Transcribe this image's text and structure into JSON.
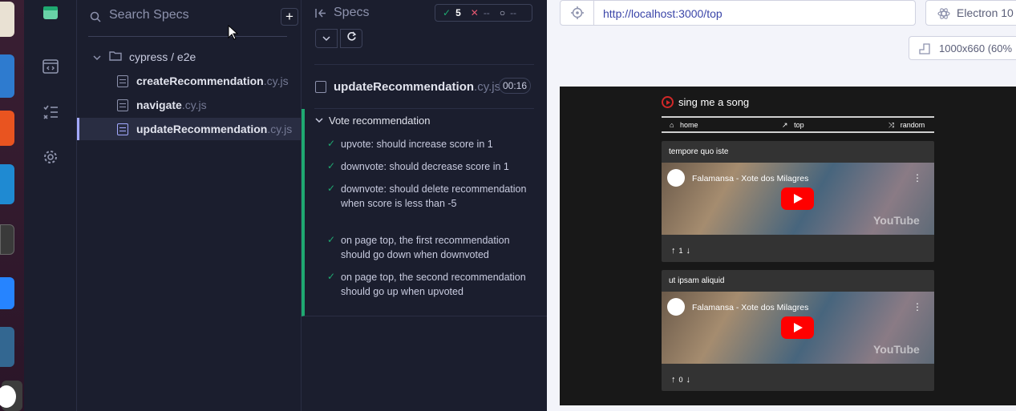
{
  "dock": {
    "apps": [
      {
        "name": "files",
        "color": "#e9e1d3"
      },
      {
        "name": "libreoffice-writer",
        "color": "#2e7bcf"
      },
      {
        "name": "software-center",
        "color": "#e95420"
      },
      {
        "name": "vscode",
        "color": "#1f8ad2"
      },
      {
        "name": "terminal",
        "color": "#3a3a3a"
      },
      {
        "name": "sourcetree",
        "color": "#2684ff"
      },
      {
        "name": "postgres",
        "color": "#336791"
      },
      {
        "name": "cypress",
        "color": "#ffffff"
      }
    ]
  },
  "rail": {
    "icons": [
      "cypress-logo-icon",
      "specs-browser-icon",
      "runs-list-icon",
      "settings-gear-icon"
    ]
  },
  "specs": {
    "search_placeholder": "Search Specs",
    "add_label": "+",
    "folder": "cypress / e2e",
    "files": [
      {
        "name": "createRecommendation",
        "ext": ".cy.js",
        "active": false
      },
      {
        "name": "navigate",
        "ext": ".cy.js",
        "active": false
      },
      {
        "name": "updateRecommendation",
        "ext": ".cy.js",
        "active": true
      }
    ]
  },
  "reporter": {
    "title": "Specs",
    "stats": {
      "passed": "5",
      "failed": "--",
      "pending": "--"
    },
    "run_file": {
      "name": "updateRecommendation",
      "ext": ".cy.js",
      "duration": "00:16"
    },
    "suite_title": "Vote recommendation",
    "tests": [
      "upvote: should increase score in 1",
      "downvote: should decrease score in 1",
      "downvote: should delete recommendation when score is less than -5",
      "on page top, the first recommendation should go down when downvoted",
      "on page top, the second recommendation should go up when upvoted"
    ]
  },
  "browser": {
    "url": "http://localhost:3000/top",
    "browser_name": "Electron 10",
    "viewport": "1000x660 (60%"
  },
  "app": {
    "logo_text": "sing me a song",
    "nav": [
      "home",
      "top",
      "random"
    ],
    "cards": [
      {
        "title": "tempore quo iste",
        "video_title": "Falamansa - Xote dos Milagres",
        "score": "1"
      },
      {
        "title": "ut ipsam aliquid",
        "video_title": "Falamansa - Xote dos Milagres",
        "score": "0"
      }
    ],
    "yt_wordmark": "YouTube"
  }
}
